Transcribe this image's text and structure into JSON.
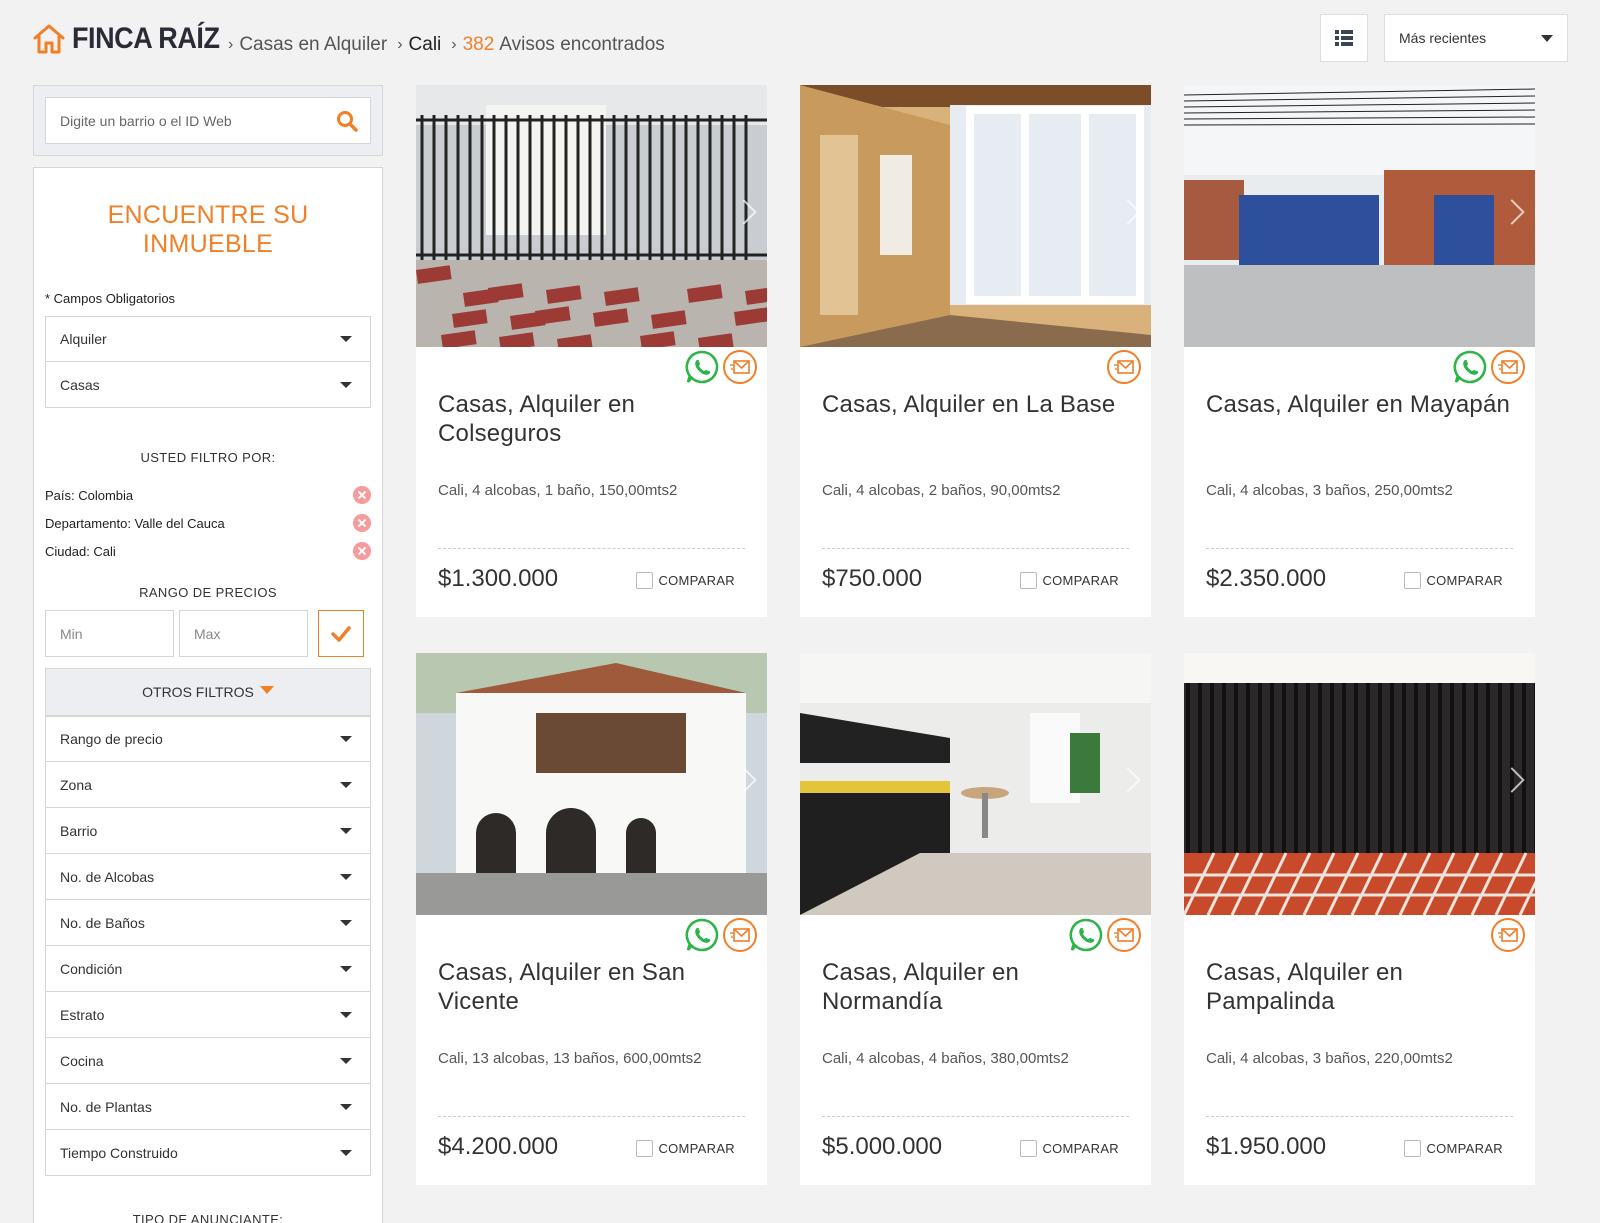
{
  "header": {
    "brand": "FINCA RAÍZ",
    "breadcrumbs": [
      "Casas en Alquiler",
      "Cali"
    ],
    "result_count": "382",
    "result_label": "Avisos encontrados",
    "sort_label": "Más recientes"
  },
  "search": {
    "placeholder": "Digite un barrio o el ID Web"
  },
  "sidebar": {
    "title": "ENCUENTRE SU INMUEBLE",
    "required_note": "* Campos Obligatorios",
    "required_selects": [
      "Alquiler",
      "Casas"
    ],
    "filtered_by_title": "USTED FILTRO POR:",
    "active_filters": [
      "País: Colombia",
      "Departamento: Valle del Cauca",
      "Ciudad: Cali"
    ],
    "price_range_title": "RANGO DE PRECIOS",
    "price_min_placeholder": "Min",
    "price_max_placeholder": "Max",
    "other_filters_label": "OTROS FILTROS",
    "other_filters": [
      "Rango de precio",
      "Zona",
      "Barrio",
      "No. de Alcobas",
      "No. de Baños",
      "Condición",
      "Estrato",
      "Cocina",
      "No. de Plantas",
      "Tiempo Construido"
    ],
    "advertiser_title": "TIPO DE ANUNCIANTE:"
  },
  "compare_label": "COMPARAR",
  "listings": [
    {
      "title": "Casas, Alquiler en Colseguros",
      "details": "Cali, 4 alcobas, 1 baño, 150,00mts2",
      "price": "$1.300.000",
      "whatsapp": true
    },
    {
      "title": "Casas, Alquiler en La Base",
      "details": "Cali, 4 alcobas, 2 baños, 90,00mts2",
      "price": "$750.000",
      "whatsapp": false
    },
    {
      "title": "Casas, Alquiler en Mayapán",
      "details": "Cali, 4 alcobas, 3 baños, 250,00mts2",
      "price": "$2.350.000",
      "whatsapp": true
    },
    {
      "title": "Casas, Alquiler en San Vicente",
      "details": "Cali, 13 alcobas, 13 baños, 600,00mts2",
      "price": "$4.200.000",
      "whatsapp": true
    },
    {
      "title": "Casas, Alquiler en Normandía",
      "details": "Cali, 4 alcobas, 4 baños, 380,00mts2",
      "price": "$5.000.000",
      "whatsapp": true
    },
    {
      "title": "Casas, Alquiler en Pampalinda",
      "details": "Cali, 4 alcobas, 3 baños, 220,00mts2",
      "price": "$1.950.000",
      "whatsapp": false
    }
  ],
  "colors": {
    "accent": "#f07f28",
    "whatsapp": "#2fb44a",
    "background": "#f2f2f3"
  }
}
